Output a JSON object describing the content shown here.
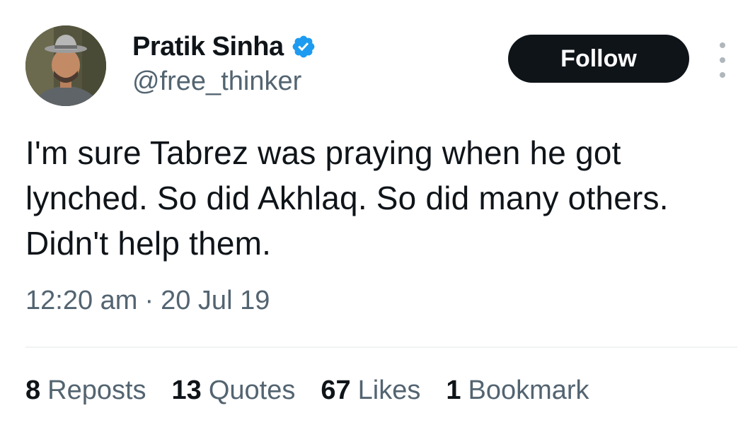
{
  "author": {
    "display_name": "Pratik Sinha",
    "handle": "@free_thinker",
    "verified": true,
    "avatar_icon": "user-avatar",
    "verified_icon": "verified-badge-icon"
  },
  "actions": {
    "follow_label": "Follow",
    "more_icon": "more-options-icon"
  },
  "tweet": {
    "text": "I'm sure Tabrez was praying when he got lynched. So did Akhlaq. So did many others. Didn't help them.",
    "time": "12:20 am",
    "separator": "·",
    "date": "20 Jul 19"
  },
  "stats": [
    {
      "count": "8",
      "label": "Reposts"
    },
    {
      "count": "13",
      "label": "Quotes"
    },
    {
      "count": "67",
      "label": "Likes"
    },
    {
      "count": "1",
      "label": "Bookmark"
    }
  ],
  "colors": {
    "text_primary": "#0f1419",
    "text_secondary": "#536471",
    "follow_button_bg": "#0f1419",
    "follow_button_text": "#ffffff",
    "verified_badge": "#1d9bf0",
    "divider": "#eff3f4"
  }
}
